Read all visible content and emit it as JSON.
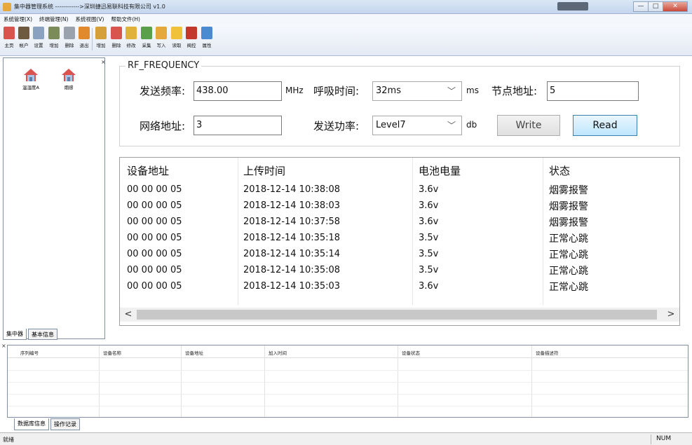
{
  "window": {
    "title": "集中器管理系统 ------------>深圳捷迅易联科技有限公司 v1.0",
    "minimize_label": "—",
    "maximize_label": "□",
    "close_label": "✕"
  },
  "menu": [
    "系统管理(X)",
    "终端管理(N)",
    "系统视图(V)",
    "帮助文件(H)"
  ],
  "toolbar": [
    {
      "label": "主页",
      "icon": "home-icon",
      "color": "#d9534f"
    },
    {
      "label": "帐户",
      "icon": "user-icon",
      "color": "#6d5a3f"
    },
    {
      "label": "设置",
      "icon": "gear-icon",
      "color": "#8aa2c0"
    },
    {
      "label": "增加",
      "icon": "add-bank-icon",
      "color": "#7b8c5a"
    },
    {
      "label": "删除",
      "icon": "delete-icon",
      "color": "#9aa3ad"
    },
    {
      "label": "退出",
      "icon": "exit-icon",
      "color": "#e08a2d"
    },
    {
      "label": "增加",
      "icon": "add-folder-icon",
      "color": "#d5a03a"
    },
    {
      "label": "删除",
      "icon": "trash-icon",
      "color": "#d9534f"
    },
    {
      "label": "修改",
      "icon": "edit-icon",
      "color": "#e0b23a"
    },
    {
      "label": "采集",
      "icon": "collect-icon",
      "color": "#5a9f4a"
    },
    {
      "label": "写入",
      "icon": "write-icon",
      "color": "#e5a93b"
    },
    {
      "label": "读取",
      "icon": "read-icon",
      "color": "#f0c23a"
    },
    {
      "label": "阀控",
      "icon": "valve-icon",
      "color": "#c0392b"
    },
    {
      "label": "属性",
      "icon": "properties-icon",
      "color": "#4a8ad0"
    }
  ],
  "left_panel": {
    "close_label": "×",
    "items": [
      {
        "label": "温湿度A",
        "icon": "house-icon"
      },
      {
        "label": "烟感",
        "icon": "house-icon"
      }
    ],
    "tabs": [
      "集中器",
      "基本信息"
    ]
  },
  "rf": {
    "group_title": "RF_FREQUENCY",
    "send_freq_label": "发送频率:",
    "send_freq_value": "438.00",
    "send_freq_unit": "MHz",
    "breath_label": "呼吸时间:",
    "breath_value": "32ms",
    "breath_unit": "ms",
    "node_label": "节点地址:",
    "node_value": "5",
    "net_label": "网络地址:",
    "net_value": "3",
    "power_label": "发送功率:",
    "power_value": "Level7",
    "power_unit": "db",
    "write_label": "Write",
    "read_label": "Read"
  },
  "grid": {
    "columns": [
      "设备地址",
      "上传时间",
      "电池电量",
      "状态"
    ],
    "rows": [
      [
        "00 00 00 05",
        "2018-12-14 10:38:08",
        "3.6v",
        "烟雾报警"
      ],
      [
        "00 00 00 05",
        "2018-12-14 10:38:03",
        "3.6v",
        "烟雾报警"
      ],
      [
        "00 00 00 05",
        "2018-12-14 10:37:58",
        "3.6v",
        "烟雾报警"
      ],
      [
        "00 00 00 05",
        "2018-12-14 10:35:18",
        "3.5v",
        "正常心跳"
      ],
      [
        "00 00 00 05",
        "2018-12-14 10:35:14",
        "3.5v",
        "正常心跳"
      ],
      [
        "00 00 00 05",
        "2018-12-14 10:35:08",
        "3.5v",
        "正常心跳"
      ],
      [
        "00 00 00 05",
        "2018-12-14 10:35:03",
        "3.6v",
        "正常心跳"
      ]
    ],
    "scroll_left": "<",
    "scroll_right": ">"
  },
  "bottom_panel": {
    "close_label": "×",
    "columns": [
      "序列编号",
      "设备名称",
      "设备地址",
      "加入时间",
      "设备状态",
      "设备描述符"
    ],
    "tabs": [
      "数据库信息",
      "操作记录"
    ]
  },
  "status": {
    "left": "就绪",
    "right": "NUM"
  },
  "colors": {
    "read_button_border": "#3c7fb1",
    "read_button_fill": "#bee6fd",
    "house_roof": "#d9534f"
  }
}
